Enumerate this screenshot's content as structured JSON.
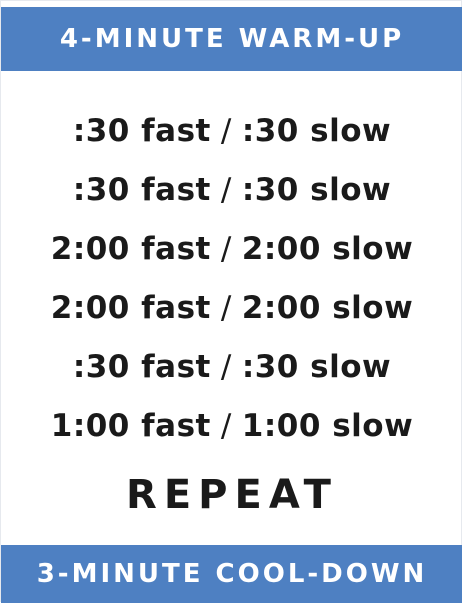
{
  "header": {
    "title": "4-MINUTE WARM-UP"
  },
  "intervals": [
    {
      "fast": ":30 fast",
      "separator": "/",
      "slow": ":30 slow"
    },
    {
      "fast": ":30 fast",
      "separator": "/",
      "slow": ":30 slow"
    },
    {
      "fast": "2:00 fast",
      "separator": "/",
      "slow": "2:00 slow"
    },
    {
      "fast": "2:00 fast",
      "separator": "/",
      "slow": "2:00 slow"
    },
    {
      "fast": ":30 fast",
      "separator": "/",
      "slow": ":30 slow"
    },
    {
      "fast": "1:00 fast",
      "separator": "/",
      "slow": "1:00 slow"
    }
  ],
  "repeat_label": "REPEAT",
  "footer": {
    "title": "3-MINUTE COOL-DOWN"
  },
  "colors": {
    "banner": "#4e80c2",
    "text": "#1a1a1a",
    "background": "#ffffff"
  }
}
